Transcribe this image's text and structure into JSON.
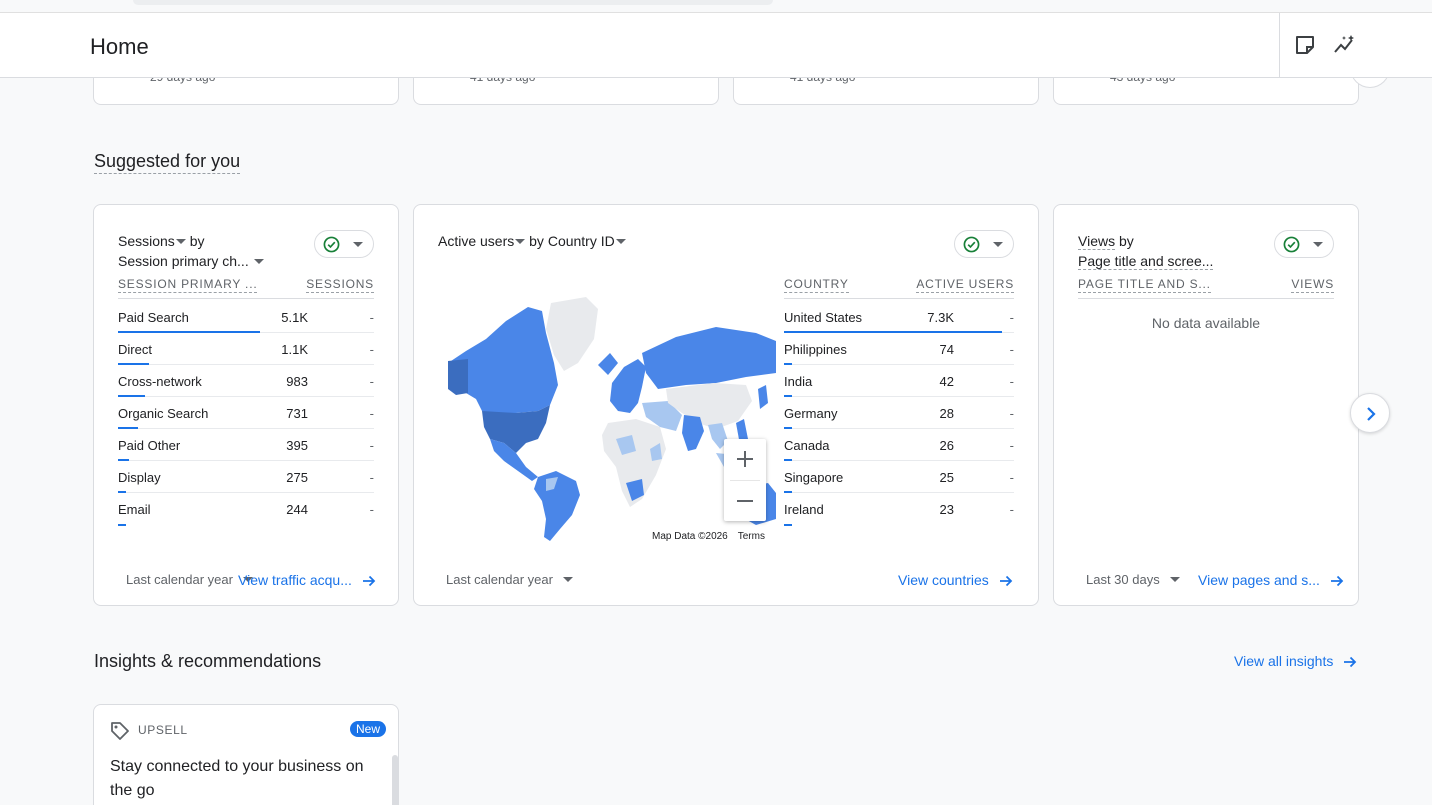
{
  "header": {
    "title": "Home",
    "icons": [
      "notes-icon",
      "insights-sparkline-icon"
    ]
  },
  "previous_cards": [
    {
      "ago": "29 days ago"
    },
    {
      "ago": "41 days ago"
    },
    {
      "ago": "41 days ago"
    },
    {
      "ago": "43 days ago"
    }
  ],
  "suggested": {
    "title": "Suggested for you",
    "cards": [
      {
        "title_metric": "Sessions",
        "title_by": "by",
        "title_dimension": "Session primary ch...",
        "col1": "SESSION PRIMARY ...",
        "col2": "SESSIONS",
        "rows": [
          {
            "label": "Paid Search",
            "value": "5.1K",
            "dash": "-",
            "fraction": 1.0
          },
          {
            "label": "Direct",
            "value": "1.1K",
            "dash": "-",
            "fraction": 0.22
          },
          {
            "label": "Cross-network",
            "value": "983",
            "dash": "-",
            "fraction": 0.19
          },
          {
            "label": "Organic Search",
            "value": "731",
            "dash": "-",
            "fraction": 0.14
          },
          {
            "label": "Paid Other",
            "value": "395",
            "dash": "-",
            "fraction": 0.08
          },
          {
            "label": "Display",
            "value": "275",
            "dash": "-",
            "fraction": 0.05
          },
          {
            "label": "Email",
            "value": "244",
            "dash": "-",
            "fraction": 0.05
          }
        ],
        "date_range": "Last calendar year",
        "link": "View traffic acqu..."
      },
      {
        "title_metric": "Active users",
        "title_by": "by",
        "title_dimension": "Country ID",
        "col1": "COUNTRY",
        "col2": "ACTIVE USERS",
        "rows": [
          {
            "label": "United States",
            "value": "7.3K",
            "dash": "-",
            "fraction": 1.0
          },
          {
            "label": "Philippines",
            "value": "74",
            "dash": "-",
            "fraction": 0.01
          },
          {
            "label": "India",
            "value": "42",
            "dash": "-",
            "fraction": 0.006
          },
          {
            "label": "Germany",
            "value": "28",
            "dash": "-",
            "fraction": 0.004
          },
          {
            "label": "Canada",
            "value": "26",
            "dash": "-",
            "fraction": 0.004
          },
          {
            "label": "Singapore",
            "value": "25",
            "dash": "-",
            "fraction": 0.003
          },
          {
            "label": "Ireland",
            "value": "23",
            "dash": "-",
            "fraction": 0.003
          }
        ],
        "map_attribution": "Map Data ©2026",
        "map_terms": "Terms",
        "date_range": "Last calendar year",
        "link": "View countries"
      },
      {
        "title_metric": "Views",
        "title_by": "by",
        "title_dimension": "Page title and scree...",
        "col1": "PAGE TITLE AND S...",
        "col2": "VIEWS",
        "no_data": "No data available",
        "date_range": "Last 30 days",
        "link": "View pages and s..."
      }
    ]
  },
  "insights": {
    "title": "Insights & recommendations",
    "link": "View all insights",
    "card": {
      "label": "UPSELL",
      "badge": "New",
      "text": "Stay connected to your business on the go"
    }
  },
  "colors": {
    "accent": "#1a73e8",
    "map_dark": "#3b6dbf",
    "map_mid": "#4a86e8",
    "map_light": "#a8c7f0",
    "map_empty": "#e8eaed"
  }
}
